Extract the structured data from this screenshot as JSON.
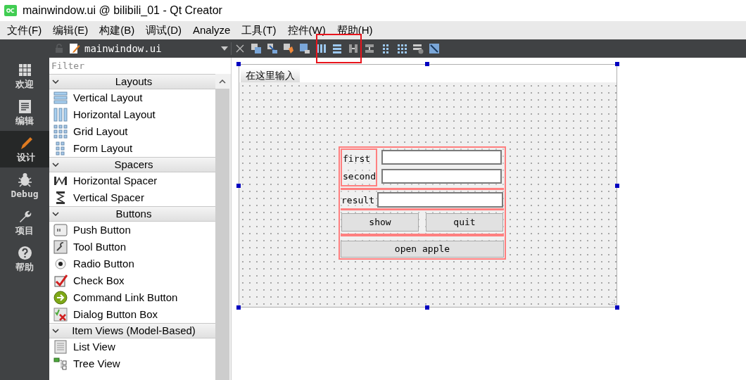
{
  "window": {
    "title": "mainwindow.ui @ bilibili_01 - Qt Creator"
  },
  "menu": [
    "文件(F)",
    "编辑(E)",
    "构建(B)",
    "调试(D)",
    "Analyze",
    "工具(T)",
    "控件(W)",
    "帮助(H)"
  ],
  "editor_tab": {
    "file": "mainwindow.ui"
  },
  "mode_bar": [
    {
      "label": "欢迎",
      "kind": "welcome",
      "selected": false
    },
    {
      "label": "编辑",
      "kind": "edit",
      "selected": false
    },
    {
      "label": "设计",
      "kind": "design",
      "selected": true
    },
    {
      "label": "Debug",
      "kind": "debug",
      "selected": false
    },
    {
      "label": "项目",
      "kind": "projects",
      "selected": false
    },
    {
      "label": "帮助",
      "kind": "help",
      "selected": false
    }
  ],
  "widget_box": {
    "filter": {
      "placeholder": "Filter"
    },
    "categories": [
      {
        "title": "Layouts",
        "expanded": true,
        "items": [
          {
            "label": "Vertical Layout",
            "kind": "vlayout"
          },
          {
            "label": "Horizontal Layout",
            "kind": "hlayout"
          },
          {
            "label": "Grid Layout",
            "kind": "grid"
          },
          {
            "label": "Form Layout",
            "kind": "form"
          }
        ]
      },
      {
        "title": "Spacers",
        "expanded": true,
        "items": [
          {
            "label": "Horizontal Spacer",
            "kind": "hspacer"
          },
          {
            "label": "Vertical Spacer",
            "kind": "vspacer"
          }
        ]
      },
      {
        "title": "Buttons",
        "expanded": true,
        "items": [
          {
            "label": "Push Button",
            "kind": "push"
          },
          {
            "label": "Tool Button",
            "kind": "tool"
          },
          {
            "label": "Radio Button",
            "kind": "radio"
          },
          {
            "label": "Check Box",
            "kind": "check"
          },
          {
            "label": "Command Link Button",
            "kind": "link"
          },
          {
            "label": "Dialog Button Box",
            "kind": "dialog"
          }
        ]
      },
      {
        "title": "Item Views (Model-Based)",
        "expanded": true,
        "items": [
          {
            "label": "List View",
            "kind": "list"
          },
          {
            "label": "Tree View",
            "kind": "tree"
          }
        ]
      }
    ]
  },
  "form": {
    "menu_entry": "在这里输入",
    "fields": [
      {
        "label": "first"
      },
      {
        "label": "second"
      },
      {
        "label": "result"
      }
    ],
    "buttons": [
      {
        "label": "show"
      },
      {
        "label": "quit"
      },
      {
        "label": "open apple"
      }
    ]
  }
}
